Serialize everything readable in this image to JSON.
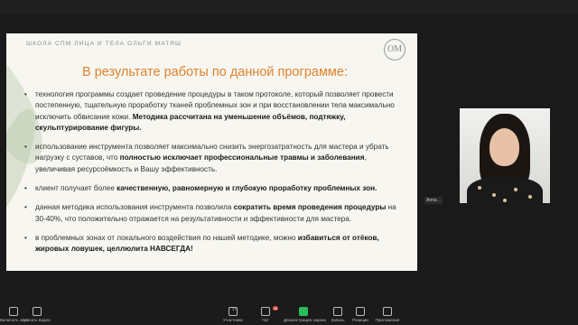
{
  "slide": {
    "header": "ШКОЛА СПМ ЛИЦА И ТЕЛА ОЛЬГИ МАТЯШ",
    "logo": "ОМ",
    "title": "В результате работы по данной программе:",
    "bullets": [
      {
        "pre": "технология программы создает проведение процедуры в таком протоколе, который позволяет провести постепенную, тщательную проработку тканей проблемных зон и при восстановлении тела максимально исключить обвисание кожи. ",
        "bold": "Методика рассчитана на уменьшение объёмов, подтяжку, скульптурирование фигуры.",
        "post": ""
      },
      {
        "pre": "использование инструмента позволяет максимально снизить энергозатратность для мастера и убрать нагрузку с суставов, что ",
        "bold": "полностью исключает профессиональные травмы и заболевания",
        "post": ", увеличивая ресурсоёмкость и Вашу эффективность."
      },
      {
        "pre": "клиент получает более ",
        "bold": "качественную, равномерную и глубокую проработку проблемных зон.",
        "post": ""
      },
      {
        "pre": "данная методика использования инструмента позволила ",
        "bold": "сократить время проведения процедуры",
        "post": " на 30-40%, что положительно отражается на результативности и эффективности для мастера."
      },
      {
        "pre": "в проблемных зонах от локального воздействия по нашей методике, можно ",
        "bold": "избавиться от отёков, жировых ловушек, целлюлита НАВСЕГДА!",
        "post": ""
      }
    ]
  },
  "participant": {
    "name": "Anna .."
  },
  "toolbar": {
    "items": [
      {
        "label": "Включить звук",
        "icon": "mic-icon"
      },
      {
        "label": "Начать видео",
        "icon": "camera-icon"
      },
      {
        "label": "Участники",
        "icon": "participants-icon",
        "count": "17"
      },
      {
        "label": "Чат",
        "icon": "chat-icon",
        "badge": "45"
      },
      {
        "label": "Демонстрация экрана",
        "icon": "share-screen-icon"
      },
      {
        "label": "Запись",
        "icon": "record-icon"
      },
      {
        "label": "Реакции",
        "icon": "reactions-icon"
      },
      {
        "label": "Приложения",
        "icon": "apps-icon"
      }
    ]
  }
}
